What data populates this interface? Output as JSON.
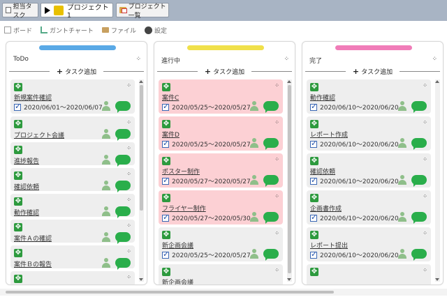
{
  "tabs": [
    {
      "label": "担当タスク"
    },
    {
      "label": "プロジェクト1"
    },
    {
      "label": "プロジェクト一覧"
    }
  ],
  "toolbar": {
    "board": "ボード",
    "gantt": "ガントチャート",
    "file": "ファイル",
    "settings": "設定"
  },
  "colors": {
    "todo": "#5aa9e6",
    "doing": "#f0e04a",
    "done": "#f07cb8",
    "highlight_card": "#fcd0d4"
  },
  "columns": [
    {
      "title": "ToDo",
      "add_label": "タスク追加",
      "cards": [
        {
          "title": "新規案件確認",
          "date": "2020/06/01～2020/06/07"
        },
        {
          "title": "プロジェクト会議"
        },
        {
          "title": "進捗報告"
        },
        {
          "title": "確認依頼"
        },
        {
          "title": "動作確認"
        },
        {
          "title": "案件Ａの確認"
        },
        {
          "title": "案件Ｂの報告"
        }
      ]
    },
    {
      "title": "進行中",
      "add_label": "タスク追加",
      "cards": [
        {
          "title": "案件C",
          "date": "2020/05/25～2020/05/27"
        },
        {
          "title": "案件D",
          "date": "2020/05/25～2020/05/27"
        },
        {
          "title": "ポスター制作",
          "date": "2020/05/27～2020/05/27"
        },
        {
          "title": "フライヤー制作",
          "date": "2020/05/27～2020/05/30"
        },
        {
          "title": "新企画会議",
          "date": "2020/05/25～2020/05/27"
        },
        {
          "title": "新企画会議"
        }
      ]
    },
    {
      "title": "完了",
      "add_label": "タスク追加",
      "cards": [
        {
          "title": "動作確認",
          "date": "2020/06/10～2020/06/20"
        },
        {
          "title": "レポート作成",
          "date": "2020/06/10～2020/06/20"
        },
        {
          "title": "確認依頼",
          "date": "2020/06/10～2020/06/20"
        },
        {
          "title": "企画書作成",
          "date": "2020/06/10～2020/06/20"
        },
        {
          "title": "レポート提出",
          "date": "2020/06/10～2020/06/20"
        }
      ]
    }
  ]
}
